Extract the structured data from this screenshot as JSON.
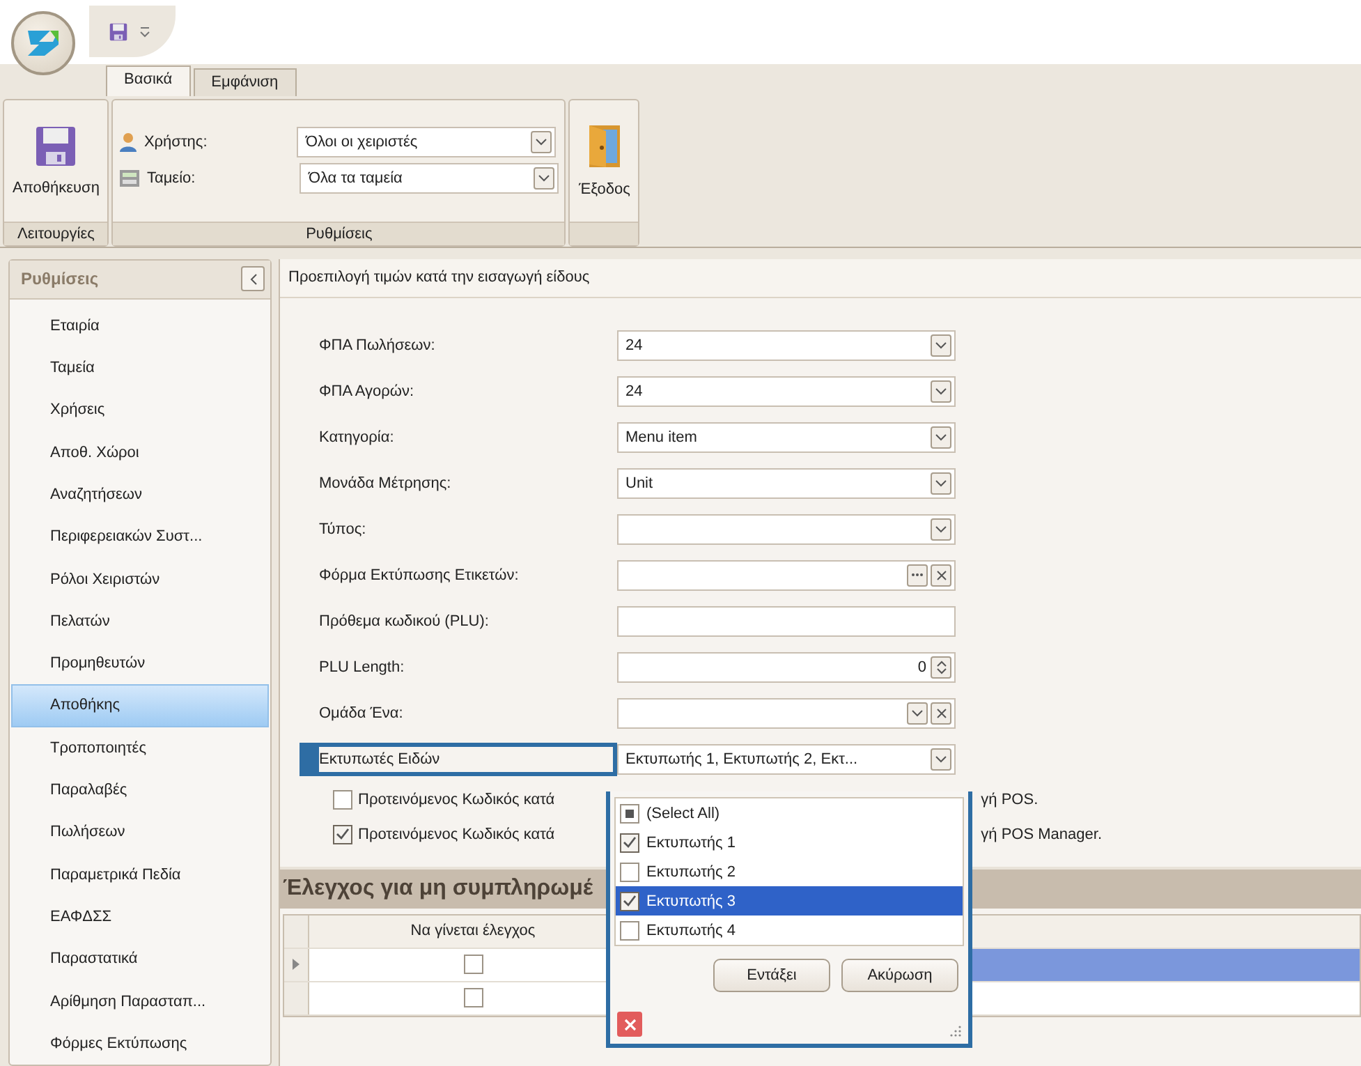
{
  "ribbon": {
    "tabs": [
      {
        "label": "Βασικά",
        "selected": true
      },
      {
        "label": "Εμφάνιση",
        "selected": false
      }
    ],
    "groups": [
      {
        "kind": "buttons",
        "caption": "Λειτουργίες",
        "buttons": [
          {
            "label": "Αποθήκευση",
            "kind": "save"
          }
        ]
      },
      {
        "kind": "fields",
        "caption": "Ρυθμίσεις",
        "fields": [
          {
            "label": "Χρήστης:",
            "value": "Όλοι οι χειριστές",
            "kind": "user"
          },
          {
            "label": "Ταμείο:",
            "value": "Όλα τα ταμεία",
            "kind": "register"
          }
        ]
      },
      {
        "kind": "buttons",
        "buttons": [
          {
            "label": "Έξοδος",
            "kind": "exit"
          }
        ]
      }
    ]
  },
  "sidebar": {
    "title": "Ρυθμίσεις",
    "items": [
      {
        "label": "Εταιρία",
        "selected": false
      },
      {
        "label": "Ταμεία",
        "selected": false
      },
      {
        "label": "Χρήσεις",
        "selected": false
      },
      {
        "label": "Αποθ. Χώροι",
        "selected": false
      },
      {
        "label": "Αναζητήσεων",
        "selected": false
      },
      {
        "label": "Περιφερειακών Συστ...",
        "selected": false
      },
      {
        "label": "Ρόλοι Χειριστών",
        "selected": false
      },
      {
        "label": "Πελατών",
        "selected": false
      },
      {
        "label": "Προμηθευτών",
        "selected": false
      },
      {
        "label": "Αποθήκης",
        "selected": true
      },
      {
        "label": "Τροποποιητές",
        "selected": false
      },
      {
        "label": "Παραλαβές",
        "selected": false
      },
      {
        "label": "Πωλήσεων",
        "selected": false
      },
      {
        "label": "Παραμετρικά Πεδία",
        "selected": false
      },
      {
        "label": "ΕΑΦΔΣΣ",
        "selected": false
      },
      {
        "label": "Παραστατικά",
        "selected": false
      },
      {
        "label": "Αρίθμηση Παρασταπ...",
        "selected": false
      },
      {
        "label": "Φόρμες Εκτύπωσης",
        "selected": false
      }
    ]
  },
  "panel": {
    "title": "Προεπιλογή τιμών κατά την εισαγωγή είδους",
    "fields": [
      {
        "label": "ΦΠΑ Πωλήσεων:",
        "value": "24",
        "kind": "combo",
        "focused": false
      },
      {
        "label": "ΦΠΑ Αγορών:",
        "value": "24",
        "kind": "combo",
        "focused": false
      },
      {
        "label": "Κατηγορία:",
        "value": "Menu item",
        "kind": "combo",
        "focused": false
      },
      {
        "label": "Μονάδα Μέτρησης:",
        "value": "Unit",
        "kind": "combo",
        "focused": false
      },
      {
        "label": "Τύπος:",
        "kind": "combo",
        "focused": false
      },
      {
        "label": "Φόρμα Εκτύπωσης Ετικετών:",
        "kind": "picker",
        "focused": false
      },
      {
        "label": "Πρόθεμα κωδικού (PLU):",
        "kind": "text",
        "focused": false
      },
      {
        "label": "PLU Length:",
        "value": "0",
        "kind": "spin",
        "focused": false
      },
      {
        "label": "Ομάδα Ένα:",
        "kind": "combo_clear",
        "focused": false
      },
      {
        "label": "Εκτυπωτές Ειδών",
        "value": "Εκτυπωτής 1, Εκτυπωτής 2, Εκτ...",
        "kind": "combo",
        "focused": true
      }
    ],
    "options": [
      {
        "checked": false,
        "label_start": "Προτεινόμενος Κωδικός κατά",
        "label_end": "γή POS."
      },
      {
        "checked": true,
        "label_start": "Προτεινόμενος Κωδικός κατά",
        "label_end": "γή POS Manager."
      }
    ]
  },
  "section": {
    "title": "Έλεγχος για μη συμπληρωμέ",
    "columns": [
      "Να γίνεται έλεγχος"
    ],
    "rows": [
      {
        "checked": false,
        "selected": true
      },
      {
        "checked": false,
        "selected": false
      }
    ]
  },
  "popup": {
    "items": [
      {
        "label": "(Select All)",
        "checked": false,
        "indeterminate": true,
        "selected": false
      },
      {
        "label": "Εκτυπωτής 1",
        "checked": true,
        "indeterminate": false,
        "selected": false
      },
      {
        "label": "Εκτυπωτής 2",
        "checked": false,
        "indeterminate": false,
        "selected": false
      },
      {
        "label": "Εκτυπωτής 3",
        "checked": true,
        "indeterminate": false,
        "selected": true
      },
      {
        "label": "Εκτυπωτής 4",
        "checked": false,
        "indeterminate": false,
        "selected": false
      }
    ],
    "buttons": [
      "Εντάξει",
      "Ακύρωση"
    ]
  }
}
